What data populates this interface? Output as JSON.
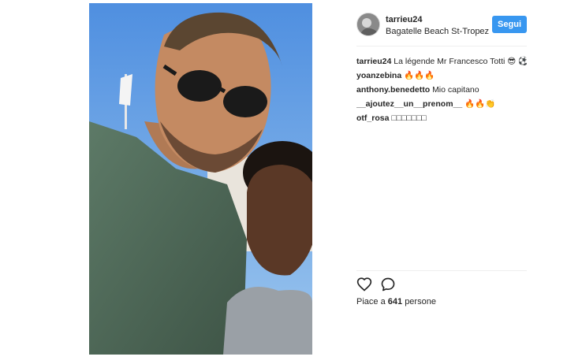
{
  "post": {
    "username": "tarrieu24",
    "location": "Bagatelle Beach St-Tropez",
    "follow_label": "Segui"
  },
  "comments": [
    {
      "user": "tarrieu24",
      "text": "La légende Mr Francesco Totti 😎 ⚽"
    },
    {
      "user": "yoanzebina",
      "text": "🔥🔥🔥"
    },
    {
      "user": "anthony.benedetto",
      "text": "Mio capitano"
    },
    {
      "user": "__ajoutez__un__prenom__",
      "text": "🔥🔥👏"
    },
    {
      "user": "otf_rosa",
      "text": "□□□□□□□"
    }
  ],
  "likes": {
    "prefix": "Piace a",
    "count": "641",
    "suffix": "persone"
  },
  "icons": {
    "like": "heart-icon",
    "comment": "comment-bubble-icon"
  },
  "colors": {
    "follow_button": "#3897f0",
    "sky": "#5a9be0"
  }
}
